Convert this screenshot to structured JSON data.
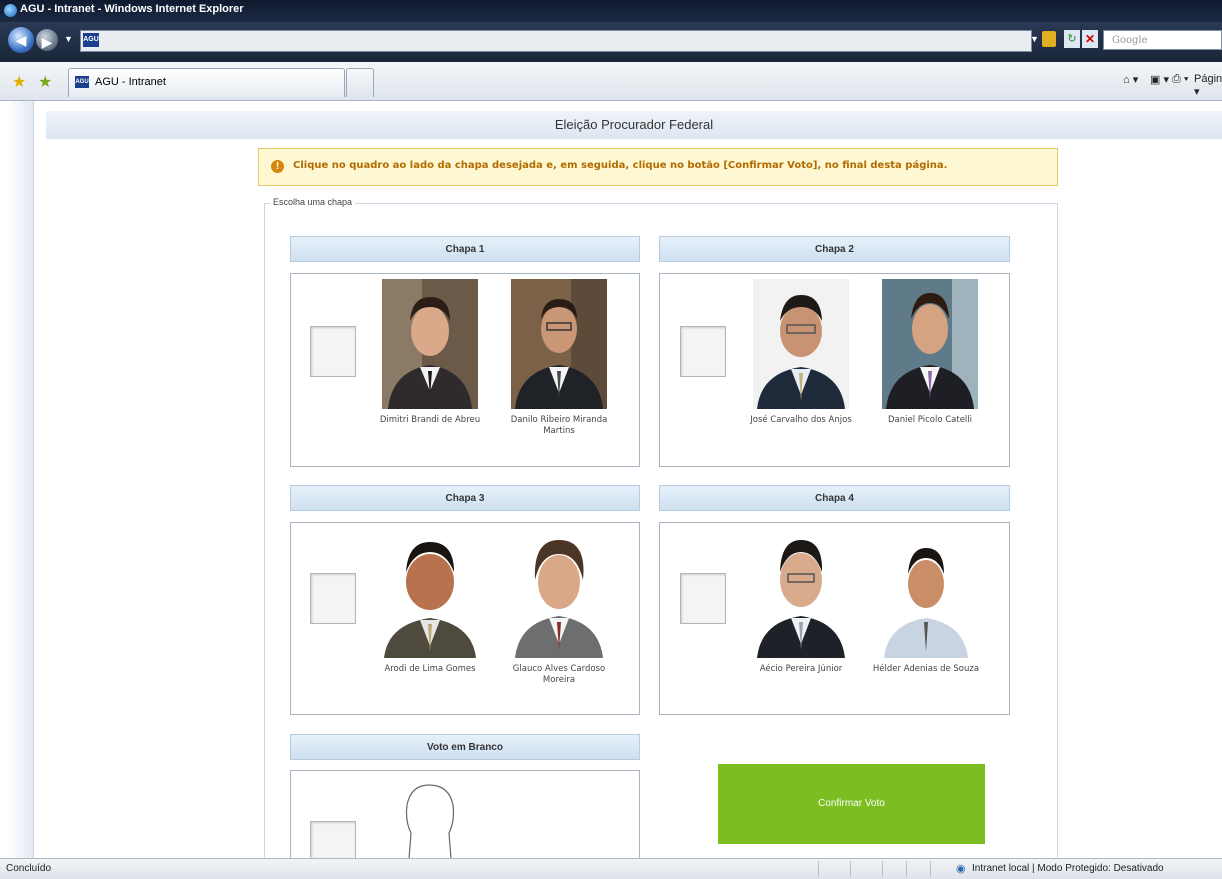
{
  "window": {
    "title": "AGU - Intranet - Windows Internet Explorer"
  },
  "address": {
    "search_placeholder": "Google"
  },
  "tabs": [
    {
      "label": "AGU - Intranet"
    }
  ],
  "commands": {
    "page_label": "Página"
  },
  "page": {
    "header_title": "Eleição Procurador Federal",
    "notice": "Clique no quadro ao lado da chapa desejada e, em seguida, clique no botão [Confirmar Voto], no final desta página.",
    "legend": "Escolha uma chapa",
    "chapas": [
      {
        "title": "Chapa 1",
        "candidates": [
          {
            "name": "Dimitri Brandi de Abreu"
          },
          {
            "name": "Danilo Ribeiro Miranda Martins"
          }
        ]
      },
      {
        "title": "Chapa 2",
        "candidates": [
          {
            "name": "José Carvalho dos Anjos"
          },
          {
            "name": "Daniel Picolo Catelli"
          }
        ]
      },
      {
        "title": "Chapa 3",
        "candidates": [
          {
            "name": "Arodi de Lima Gomes"
          },
          {
            "name": "Glauco Alves Cardoso Moreira"
          }
        ]
      },
      {
        "title": "Chapa 4",
        "candidates": [
          {
            "name": "Aécio Pereira Júnior"
          },
          {
            "name": "Hélder Adenias de Souza"
          }
        ]
      }
    ],
    "blank_vote_title": "Voto em Branco",
    "confirm_label": "Confirmar Voto"
  },
  "status": {
    "left": "Concluído",
    "right": "Intranet local | Modo Protegido: Desativado"
  },
  "colors": {
    "confirm": "#7cbd22",
    "notice_bg": "#fdf7d2",
    "notice_text": "#b36b00"
  }
}
